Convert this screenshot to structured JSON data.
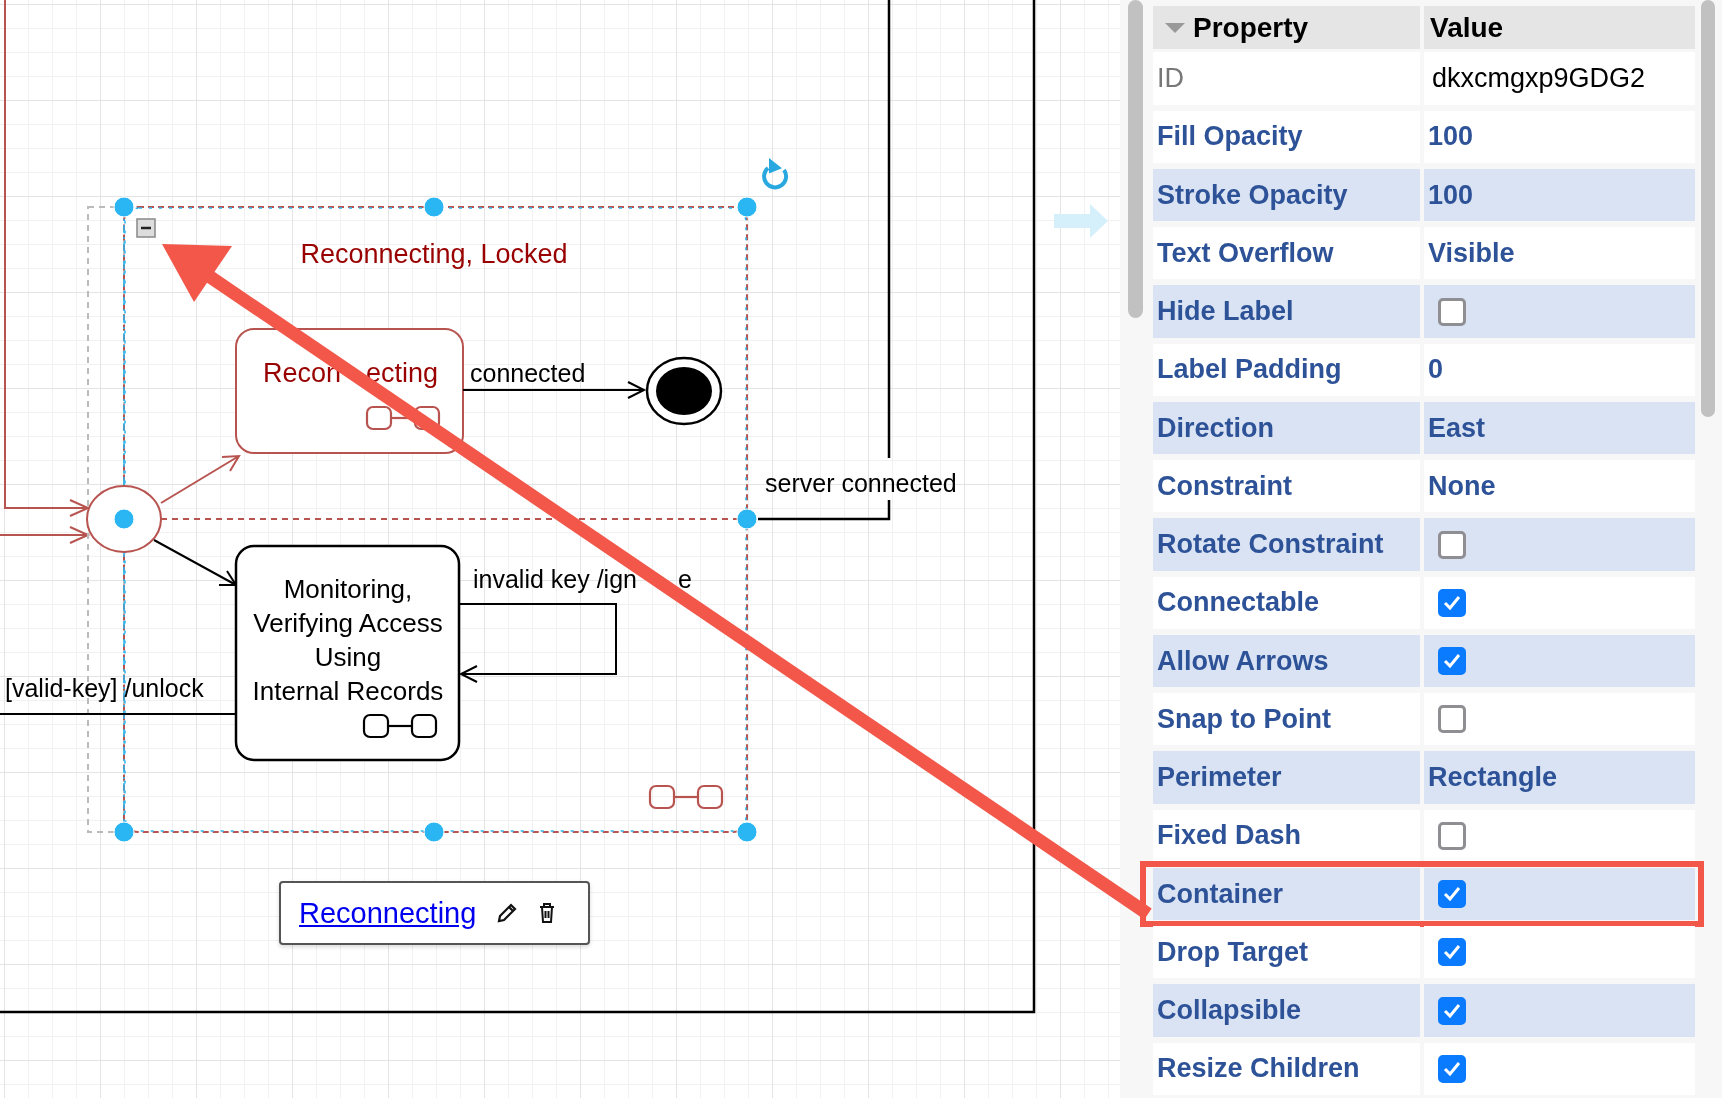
{
  "diagram": {
    "container_title": "Reconnecting, Locked",
    "state_reconnecting": [
      "Recon",
      "ecting"
    ],
    "transition_connected": "connected",
    "transition_server_connected": "server connected",
    "state_monitoring": [
      "Monitoring,",
      "Verifying Access",
      "Using",
      "Internal Records"
    ],
    "transition_invalid_key": [
      "invalid key /ign",
      "e"
    ],
    "transition_valid_key": "[valid-key] /unlock"
  },
  "label_editor": {
    "link": "Reconnecting"
  },
  "properties": {
    "header": [
      "Property",
      "Value"
    ],
    "rows": [
      {
        "label": "ID",
        "kind": "input",
        "value": "dkxcmgxp9GDG2",
        "highlighted": false
      },
      {
        "label": "Fill Opacity",
        "kind": "text",
        "value": "100",
        "highlighted": false
      },
      {
        "label": "Stroke Opacity",
        "kind": "text",
        "value": "100",
        "highlighted": false
      },
      {
        "label": "Text Overflow",
        "kind": "text",
        "value": "Visible",
        "highlighted": false
      },
      {
        "label": "Hide Label",
        "kind": "check",
        "checked": false,
        "highlighted": false
      },
      {
        "label": "Label Padding",
        "kind": "text",
        "value": "0",
        "highlighted": false
      },
      {
        "label": "Direction",
        "kind": "text",
        "value": "East",
        "highlighted": false
      },
      {
        "label": "Constraint",
        "kind": "text",
        "value": "None",
        "highlighted": false
      },
      {
        "label": "Rotate Constraint",
        "kind": "check",
        "checked": false,
        "highlighted": false
      },
      {
        "label": "Connectable",
        "kind": "check",
        "checked": true,
        "highlighted": false
      },
      {
        "label": "Allow Arrows",
        "kind": "check",
        "checked": true,
        "highlighted": false
      },
      {
        "label": "Snap to Point",
        "kind": "check",
        "checked": false,
        "highlighted": false
      },
      {
        "label": "Perimeter",
        "kind": "text",
        "value": "Rectangle",
        "highlighted": false
      },
      {
        "label": "Fixed Dash",
        "kind": "check",
        "checked": false,
        "highlighted": false
      },
      {
        "label": "Container",
        "kind": "check",
        "checked": true,
        "highlighted": true
      },
      {
        "label": "Drop Target",
        "kind": "check",
        "checked": true,
        "highlighted": false
      },
      {
        "label": "Collapsible",
        "kind": "check",
        "checked": true,
        "highlighted": false
      },
      {
        "label": "Resize Children",
        "kind": "check",
        "checked": true,
        "highlighted": false
      }
    ]
  }
}
